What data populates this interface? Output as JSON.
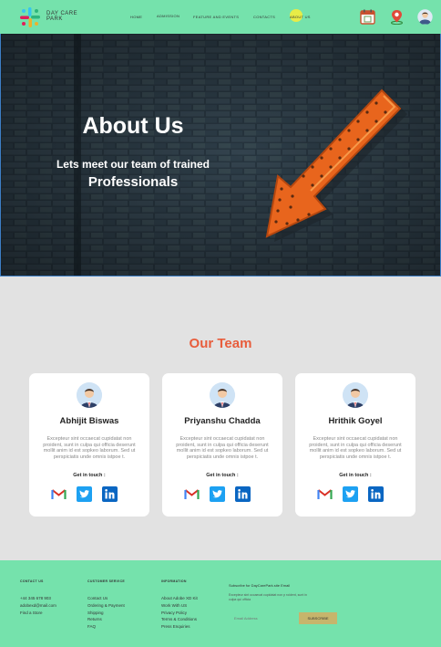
{
  "header": {
    "brand_line1": "DAY CARE",
    "brand_line2": "PARK",
    "nav": [
      "HOME",
      "ADMISSION",
      "FEATURE AND EVENTS",
      "CONTACTS",
      "ABOUT US"
    ],
    "icons": [
      "calendar-icon",
      "location-pin-icon",
      "user-avatar-icon"
    ]
  },
  "hero": {
    "title": "About Us",
    "subtitle": "Lets meet our team of trained",
    "subtitle2": "Professionals"
  },
  "team": {
    "title": "Our Team",
    "members": [
      {
        "name": "Abhijit Biswas",
        "desc": "Excepteur sint occaecat cupidatat non proident, sunt in culpa qui officia deserunt mollit anim id est sopkeo laborum. Sed ut perspiciatis unde omnis istpoe t.",
        "touch": "Get in touch :"
      },
      {
        "name": "Priyanshu Chadda",
        "desc": "Excepteur sint occaecat cupidatat non proident, sunt in culpa qui officia deserunt mollit anim id est sopkeo laborum. Sed ut perspiciatis unde omnis istpoe t.",
        "touch": "Get in touch :"
      },
      {
        "name": "Hrithik Goyel",
        "desc": "Excepteur sint occaecat cupidatat non proident, sunt in culpa qui officia deserunt mollit anim id est sopkeo laborum. Sed ut perspiciatis unde omnis istpoe t.",
        "touch": "Get in touch :"
      }
    ],
    "social_icons": [
      "gmail-icon",
      "twitter-icon",
      "linkedin-icon"
    ]
  },
  "footer": {
    "contact": {
      "heading": "CONTACT US",
      "lines": [
        "+44 345 678 903",
        "adobexd@mail.com",
        "Find a Store"
      ]
    },
    "customer": {
      "heading": "CUSTOMER SERVICE",
      "lines": [
        "Contact Us",
        "Ordering & Payment",
        "Shipping",
        "Returns",
        "FAQ"
      ]
    },
    "information": {
      "heading": "INFORMATION",
      "lines": [
        "About Adobe XD Kit",
        "Work With US",
        "Privacy Policy",
        "Terms & Conditions",
        "Press Enquiries"
      ]
    },
    "subscribe_title": "Subscribe for DayCarePark.site Email",
    "subscribe_text": "Excepteur sint occaecat cupidatat non p roident, sunt in culpa qui officia",
    "email_placeholder": "Email Address",
    "subscribe_button": "SUBSCRIBE"
  },
  "colors": {
    "header_bg": "#75e2ac",
    "team_title": "#e85d3c",
    "subscribe_button": "#c6b56c",
    "page_bg": "#e2e2e2"
  }
}
